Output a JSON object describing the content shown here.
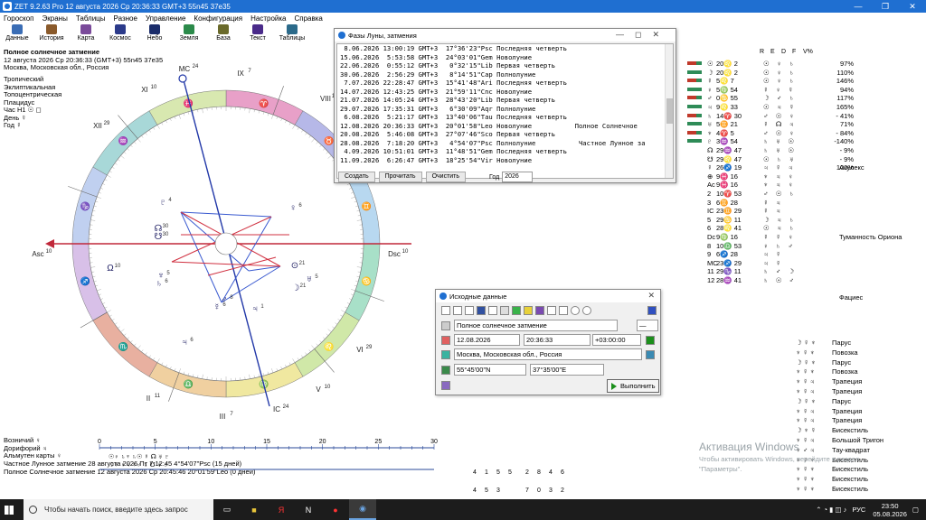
{
  "titlebar": {
    "title": "ZET 9.2.63 Pro   12 августа 2026  Ср  20:36:33 GMT+3 55n45  37e35",
    "controls": [
      "—",
      "❐",
      "✕"
    ]
  },
  "menu": [
    "Гороскоп",
    "Экраны",
    "Таблицы",
    "Разное",
    "Управление",
    "Конфигурация",
    "Настройка",
    "Справка"
  ],
  "toolbar": [
    {
      "label": "Данные",
      "icon": "data-icon",
      "color": "#3a6db5"
    },
    {
      "label": "История",
      "icon": "history-icon",
      "color": "#8a5a2b"
    },
    {
      "label": "Карта",
      "icon": "map-icon",
      "color": "#7a4a9a"
    },
    {
      "label": "Космос",
      "icon": "cosmos-icon",
      "color": "#2b3a8a"
    },
    {
      "label": "Небо",
      "icon": "sky-icon",
      "color": "#1a2c6a"
    },
    {
      "label": "Земля",
      "icon": "earth-icon",
      "color": "#2b8a4a"
    },
    {
      "label": "База",
      "icon": "database-icon",
      "color": "#6a6a2b"
    },
    {
      "label": "Текст",
      "icon": "text-icon",
      "color": "#4a2b8a"
    },
    {
      "label": "Таблицы",
      "icon": "tables-icon",
      "color": "#2b6a8a"
    }
  ],
  "chart_header": {
    "title": "Полное солнечное затмение",
    "datetime": "12 августа 2026  Ср  20:36:33 (GMT+3) 55n45  37e35",
    "place": "Москва, Московская обл., Россия"
  },
  "settings": [
    "Тропический",
    "Эклиптикальная",
    "Топоцентрическая",
    "Плацидус",
    "Час H1  ☉ ◻",
    "День  ☿",
    "Год  ☿"
  ],
  "wheel": {
    "houses": {
      "mc": "MC",
      "mc_deg": "24",
      "ic": "IC",
      "ic_deg": "24",
      "asc": "Asc",
      "asc_deg": "10",
      "dsc": "Dsc",
      "dsc_deg": "10",
      "labels": [
        {
          "t": "IX",
          "d": "7"
        },
        {
          "t": "VIII",
          "d": "11"
        },
        {
          "t": "XI",
          "d": "10"
        },
        {
          "t": "XII",
          "d": "29"
        },
        {
          "t": "VI",
          "d": "29"
        },
        {
          "t": "V",
          "d": "10"
        },
        {
          "t": "III",
          "d": "7"
        },
        {
          "t": "II",
          "d": "11"
        }
      ]
    },
    "zodiac_signs": [
      "♈",
      "♉",
      "♊",
      "♋",
      "♌",
      "♍",
      "♎",
      "♏",
      "♐",
      "♑",
      "♒",
      "♓"
    ],
    "planets": [
      {
        "glyph": "♇",
        "deg": "4"
      },
      {
        "glyph": "♆",
        "deg": "5"
      },
      {
        "glyph": "♄",
        "deg": "6"
      },
      {
        "glyph": "☊",
        "deg": "30"
      },
      {
        "glyph": "☋",
        "deg": "30"
      },
      {
        "glyph": "♅",
        "deg": "5"
      },
      {
        "glyph": "⊙",
        "deg": "21"
      },
      {
        "glyph": "☽",
        "deg": "21"
      },
      {
        "glyph": "♀",
        "deg": "6"
      },
      {
        "glyph": "♃",
        "deg": "1"
      },
      {
        "glyph": "♂",
        "deg": "8"
      },
      {
        "glyph": "☿",
        "deg": "6"
      },
      {
        "glyph": "♃",
        "deg": "6"
      },
      {
        "glyph": "Ω",
        "deg": "10"
      }
    ]
  },
  "phases_window": {
    "title": "Фазы Луны, затмения",
    "rows": [
      " 8.06.2026 13:00:19 GMT+3  17°36'23\"Psc Последняя четверть",
      "15.06.2026  5:53:58 GMT+3  24°03'01\"Gem Новолуние",
      "22.06.2026  0:55:12 GMT+3   0°32'15\"Lib Первая четверть",
      "30.06.2026  2:56:29 GMT+3   8°14'51\"Cap Полнолуние",
      " 7.07.2026 22:28:47 GMT+3  15°41'48\"Ari Последняя четверть",
      "14.07.2026 12:43:25 GMT+3  21°59'11\"Cnc Новолуние",
      "21.07.2026 14:05:24 GMT+3  28°43'20\"Lib Первая четверть",
      "29.07.2026 17:35:31 GMT+3   6°30'09\"Aqr Полнолуние",
      " 6.08.2026  5:21:17 GMT+3  13°40'06\"Tau Последняя четверть",
      "12.08.2026 20:36:33 GMT+3  20°01'58\"Leo Новолуние           Полное Солнечное",
      "20.08.2026  5:46:08 GMT+3  27°07'46\"Sco Первая четверть",
      "28.08.2026  7:18:20 GMT+3   4°54'07\"Psc Полнолуние           Частное Лунное за",
      " 4.09.2026 10:51:01 GMT+3  11°48'51\"Gem Последняя четверть",
      "11.09.2026  6:26:47 GMT+3  18°25'54\"Vir Новолуние"
    ],
    "buttons": [
      "Создать",
      "Прочитать",
      "Очистить"
    ],
    "year_label": "Год",
    "year_value": "2026"
  },
  "input_window": {
    "title": "Исходные данные",
    "name": "Полное солнечное затмение",
    "name_suffix": "—",
    "date": "12.08.2026",
    "time": "20:36:33",
    "tz": "+03:00:00",
    "place": "Москва, Московская обл., Россия",
    "lat": "55°45'00\"N",
    "lon": "37°35'00\"E",
    "exec": "Выполнить"
  },
  "right_panel": {
    "headers": [
      "R",
      "E",
      "D",
      "F",
      "V%"
    ],
    "rows": [
      {
        "b": "#c0392b",
        "g": "☉",
        "p": "20♌ 2",
        "d": "☉ ♀ ♄",
        "v": "97%"
      },
      {
        "b": "#2e8b57",
        "g": "☽",
        "p": "20♌ 2",
        "d": "☉ ♀ ♄",
        "v": "110%"
      },
      {
        "b": "#c0392b",
        "g": "☿",
        "p": "5♌ 7",
        "d": "☉ ♀ ♄",
        "v": "146%"
      },
      {
        "b": "#2e8b57",
        "g": "♀",
        "p": "5♍ 54",
        "d": "☿ ♀ ☿",
        "v": "94%"
      },
      {
        "b": "#c0392b",
        "g": "♂",
        "p": "0♋ 55",
        "d": "☽ ♂ ♄",
        "v": "117%"
      },
      {
        "b": "#2e8b57",
        "g": "♃",
        "p": "9♌ 33",
        "d": "☉ ♃ ☿",
        "v": "165%"
      },
      {
        "b": "#c0392b",
        "g": "♄",
        "p": "14♈ 30",
        "d": "♂ ☉ ♀",
        "v": "- 41%"
      },
      {
        "b": "#2e8b57",
        "g": "♅",
        "p": "5♊ 21",
        "d": "☿ ☊ ♃",
        "v": "71%"
      },
      {
        "b": "#c0392b",
        "g": "♆",
        "p": "4♈ 5",
        "d": "♂ ☉ ♀",
        "v": "- 84%"
      },
      {
        "b": "#2e8b57",
        "g": "♇",
        "p": "3♒ 54",
        "d": "♄ ♅ ☉",
        "v": "-140%"
      },
      {
        "b": "",
        "g": "☊",
        "p": "29♒ 47",
        "d": "♄ ♅ ☉",
        "v": "- 9%"
      },
      {
        "b": "",
        "g": "☋",
        "p": "29♌ 47",
        "d": "☉ ♄ ♅",
        "v": "- 9%"
      },
      {
        "b": "",
        "g": "☿",
        "p": "26♐ 19",
        "d": "♃ ☿ ♃",
        "v": "100%"
      },
      {
        "b": "",
        "g": "⊕",
        "p": "9♓ 16",
        "d": "♆ ♃ ♀",
        "v": ""
      },
      {
        "b": "",
        "g": "Ac",
        "p": "9♓ 16",
        "d": "♆ ♃ ♀",
        "v": ""
      },
      {
        "b": "",
        "g": "2",
        "p": "10♈ 53",
        "d": "♂ ☉ ♄",
        "v": ""
      },
      {
        "b": "",
        "g": "3",
        "p": "6♊ 28",
        "d": "☿ ♃ ",
        "v": ""
      },
      {
        "b": "",
        "g": "IC",
        "p": "23♊ 29",
        "d": "☿ ♃ ",
        "v": ""
      },
      {
        "b": "",
        "g": "5",
        "p": "29♋ 11",
        "d": "☽ ♃ ♄",
        "v": ""
      },
      {
        "b": "",
        "g": "6",
        "p": "28♌ 41",
        "d": "☉ ♃ ♄",
        "v": ""
      },
      {
        "b": "",
        "g": "Dc",
        "p": "9♍ 16",
        "d": "☿ ☿ ♀",
        "v": ""
      },
      {
        "b": "",
        "g": "8",
        "p": "10♎ 53",
        "d": "♀ ♄ ♂",
        "v": ""
      },
      {
        "b": "",
        "g": "9",
        "p": "6♐ 28",
        "d": "♃ ☿",
        "v": ""
      },
      {
        "b": "",
        "g": "MC",
        "p": "23♐ 29",
        "d": "♃ ☿",
        "v": ""
      },
      {
        "b": "",
        "g": "11",
        "p": "29♑ 11",
        "d": "♄ ♂ ☽",
        "v": ""
      },
      {
        "b": "",
        "g": "12",
        "p": "28♒ 41",
        "d": "♄ ☉ ♂",
        "v": ""
      }
    ],
    "stars": [
      {
        "row": 12,
        "name": "Акулекс"
      },
      {
        "row": 20,
        "name": "Туманность Ориона"
      },
      {
        "row": 27,
        "name": "Фациес"
      }
    ]
  },
  "configurations": [
    {
      "g": "☽ ☿ ♆",
      "t": "Парус"
    },
    {
      "g": "♆ ☿ ♆",
      "t": "Повозка"
    },
    {
      "g": "☽ ☿ ♆",
      "t": "Парус"
    },
    {
      "g": "♆ ☿ ♆",
      "t": "Повозка"
    },
    {
      "g": "♆ ☿ ♃",
      "t": "Трапеция"
    },
    {
      "g": "♆ ☿ ♃",
      "t": "Трапеция"
    },
    {
      "g": "☽ ☿ ♆",
      "t": "Парус"
    },
    {
      "g": "♆ ☿ ♃",
      "t": "Трапеция"
    },
    {
      "g": "♆ ☿ ♃",
      "t": "Трапеция"
    },
    {
      "g": "☽ ♆ ☿",
      "t": "Бисекстиль"
    },
    {
      "g": "♆ ☿ ♃",
      "t": "Большой Тригон"
    },
    {
      "g": "♆ ♂ ♃",
      "t": "Тау-квадрат"
    },
    {
      "g": "♆ ☿ ♆",
      "t": "Бисекстиль"
    },
    {
      "g": "♆ ☿ ♆",
      "t": "Бисекстиль"
    },
    {
      "g": "♆ ☿ ♆",
      "t": "Бисекстиль"
    },
    {
      "g": "♆ ☿ ♆",
      "t": "Бисекстиль"
    }
  ],
  "bottom_info": [
    "Возничий  ♀",
    "Дорифорий  ♃",
    "Альмутен карты  ♀",
    "Частное Лунное затмение 28 августа 2026 Пт  7:12:45  4°54'07\"Psc (15 дней)",
    "Полное Солнечное затмение 12 августа 2026 Ср 20:45:46 20°01'59\"Leo (0 дней)"
  ],
  "timeline": {
    "ticks": [
      "0",
      "5",
      "10",
      "15",
      "20",
      "25",
      "30"
    ],
    "row1": "☉♀  ♄♆  ♄☉  ☿  ☊  ♅  ♇",
    "row2": "☽☿  ♀♃  ♆♂  ♄  ☋  ♅  ♇"
  },
  "aspect_grid": {
    "top": [
      "4",
      "1",
      "5",
      "5"
    ],
    "bot": [
      "4",
      "5",
      "3"
    ],
    "top2": [
      "2",
      "8",
      "4",
      "6"
    ],
    "bot2": [
      "7",
      "0",
      "3",
      "2"
    ]
  },
  "windows_activation": {
    "line1": "Активация Windows",
    "line2": "Чтобы активировать Windows, перейдите в раздел",
    "line3": "\"Параметры\"."
  },
  "taskbar": {
    "search_placeholder": "Чтобы начать поиск, введите здесь запрос",
    "time": "23:50",
    "date": "05.08.2026",
    "lang": "РУС"
  }
}
